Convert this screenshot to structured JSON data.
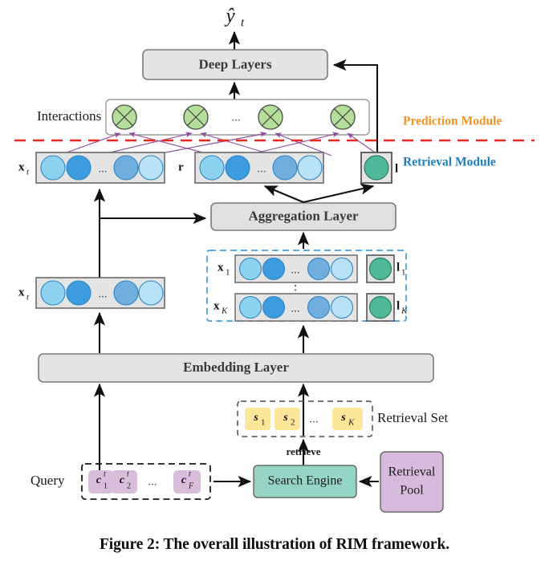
{
  "figure": {
    "caption": "Figure 2: The overall illustration of RIM framework.",
    "output_label": "ŷ",
    "output_sub": "t"
  },
  "modules": [
    {
      "name": "prediction",
      "label": "Prediction Module",
      "color": "#F39422"
    },
    {
      "name": "retrieval",
      "label": "Retrieval Module",
      "color": "#1A7FC1"
    }
  ],
  "divider": {
    "color": "#E8271E",
    "style": "dashed"
  },
  "blocks": {
    "deep_layers": {
      "label": "Deep Layers",
      "fill": "#E4E4E4",
      "stroke": "#7A7A7A"
    },
    "aggregation_layer": {
      "label": "Aggregation Layer",
      "fill": "#E0E0E0",
      "stroke": "#7A7A7A"
    },
    "embedding_layer": {
      "label": "Embedding Layer",
      "fill": "#E4E4E4",
      "stroke": "#7A7A7A"
    },
    "search_engine": {
      "label": "Search Engine",
      "fill": "#96D4C4",
      "stroke": "#6a6a6a"
    },
    "retrieval_pool": {
      "label": "Retrieval Pool",
      "line1": "Retrieval",
      "line2": "Pool",
      "fill": "#D6BBDC",
      "stroke": "#6a6a6a"
    }
  },
  "labels": {
    "interactions": "Interactions",
    "retrieval_set": "Retrieval Set",
    "query": "Query",
    "retrieve": "retrieve",
    "ellipsis": "...",
    "vdots": "⋮"
  },
  "vectors": {
    "xt_top": {
      "label": "x",
      "sub": "t"
    },
    "xt_mid": {
      "label": "x",
      "sub": "t"
    },
    "r": {
      "label": "r",
      "sub": ""
    },
    "l": {
      "label": "l",
      "sub": ""
    },
    "x1": {
      "label": "x",
      "sub": "1"
    },
    "xK": {
      "label": "x",
      "sub": "K"
    },
    "l1": {
      "label": "l",
      "sub": "1"
    },
    "lK": {
      "label": "l",
      "sub": "K"
    }
  },
  "embedding_colors": [
    "#8ED2F2",
    "#3D9BE0",
    "#6FAEDE",
    "#B9E1F7"
  ],
  "colors": {
    "interaction_node": "#B4DE9A",
    "interaction_stroke": "#4a4a4a",
    "label_node": "#4FB89A",
    "label_node_stroke": "#2e7d60",
    "vector_band_fill": "#E4E4E4",
    "vector_band_stroke": "#6a6a6a",
    "purple_arrow": "#8E4E9E",
    "dashed_blue": "#3FA0E0",
    "dashed_gray": "#4a4a4a",
    "retrieval_set_item": "#FCE69A",
    "query_item": "#D9BEDC",
    "arrow_black": "#111111"
  },
  "retrieval_set_items": [
    {
      "label": "s",
      "sub": "1"
    },
    {
      "label": "s",
      "sub": "2"
    },
    {
      "label": "s",
      "sub": "K"
    }
  ],
  "query_items": [
    {
      "label": "c",
      "sub": "1",
      "sup": "t"
    },
    {
      "label": "c",
      "sub": "2",
      "sup": "t"
    },
    {
      "label": "c",
      "sub": "F",
      "sup": "t"
    }
  ],
  "interaction_node_count": 4
}
